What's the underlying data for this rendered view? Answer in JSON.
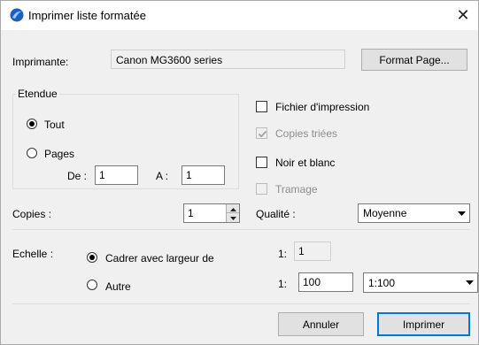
{
  "window": {
    "title": "Imprimer liste formatée",
    "close_glyph": "✕"
  },
  "printer": {
    "label": "Imprimante:",
    "name": "Canon MG3600 series",
    "format_button": "Format Page..."
  },
  "range": {
    "legend": "Etendue",
    "all_label": "Tout",
    "pages_label": "Pages",
    "from_label": "De :",
    "from_value": "1",
    "to_label": "A :",
    "to_value": "1",
    "selected": "Tout"
  },
  "options": {
    "print_file": "Fichier d'impression",
    "collated": "Copies triées",
    "black_white": "Noir et blanc",
    "dithering": "Tramage"
  },
  "copies": {
    "label": "Copies :",
    "value": "1"
  },
  "quality": {
    "label": "Qualité :",
    "value": "Moyenne"
  },
  "scale": {
    "label": "Echelle :",
    "fit_width_label": "Cadrer avec largeur de",
    "other_label": "Autre",
    "selected": "Cadrer avec largeur de",
    "ratio1_prefix": "1:",
    "ratio1_value": "1",
    "ratio2_prefix": "1:",
    "ratio2_value": "100",
    "ratio_select_value": "1:100"
  },
  "buttons": {
    "cancel": "Annuler",
    "print": "Imprimer"
  },
  "colors": {
    "accent": "#0078d7",
    "dialog_bg": "#f0f0f0"
  },
  "icons": {
    "app": "app-logo-icon",
    "close": "close-icon",
    "dropdown": "chevron-down-icon",
    "spin_up": "spin-up-icon",
    "spin_down": "spin-down-icon"
  }
}
